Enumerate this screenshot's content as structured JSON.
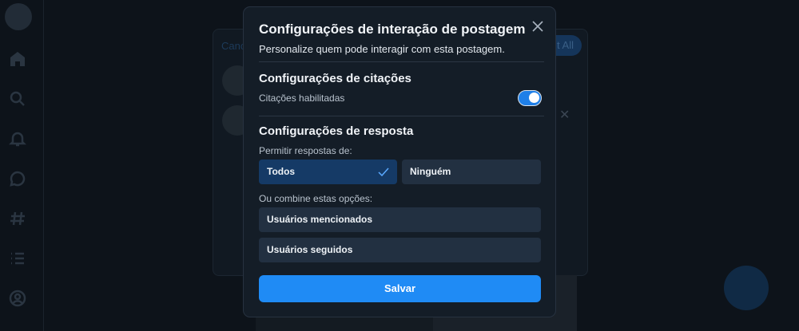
{
  "background": {
    "composer": {
      "cancel_label": "Canc",
      "post_all_label": "t All"
    }
  },
  "modal": {
    "title": "Configurações de interação de postagem",
    "subtitle": "Personalize quem pode interagir com esta postagem.",
    "close_icon": "close-icon",
    "quotes": {
      "section_title": "Configurações de citações",
      "label": "Citações habilitadas",
      "enabled": true
    },
    "replies": {
      "section_title": "Configurações de resposta",
      "allow_label": "Permitir respostas de:",
      "options": [
        {
          "label": "Todos",
          "selected": true
        },
        {
          "label": "Ninguém",
          "selected": false
        }
      ],
      "combine_label": "Ou combine estas opções:",
      "combine_options": [
        {
          "label": "Usuários mencionados"
        },
        {
          "label": "Usuários seguidos"
        }
      ]
    },
    "save_label": "Salvar"
  },
  "colors": {
    "accent": "#1f8bf5",
    "selected_option": "#153a66",
    "option": "#223041",
    "modal_bg": "#141d27"
  }
}
